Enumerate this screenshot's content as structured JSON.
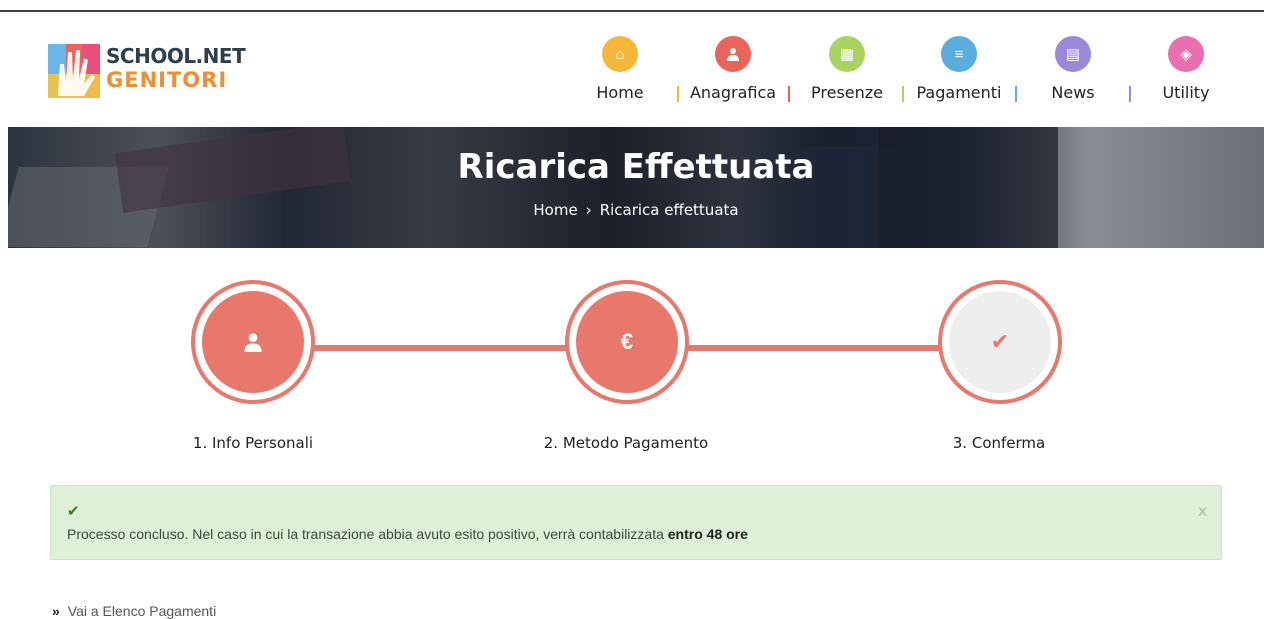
{
  "logo": {
    "line1": "SCHOOL.NET",
    "line2": "GENITORI"
  },
  "nav": [
    {
      "label": "Home",
      "icon": "home-icon",
      "color": "#f4b73a",
      "glyph": "⌂"
    },
    {
      "label": "Anagrafica",
      "icon": "user-icon",
      "color": "#e8655a",
      "glyph": "●"
    },
    {
      "label": "Presenze",
      "icon": "calendar-icon",
      "color": "#a9d360",
      "glyph": "▦"
    },
    {
      "label": "Pagamenti",
      "icon": "list-icon",
      "color": "#5aaedf",
      "glyph": "≡"
    },
    {
      "label": "News",
      "icon": "newspaper-icon",
      "color": "#9a88d8",
      "glyph": "▤"
    },
    {
      "label": "Utility",
      "icon": "utility-icon",
      "color": "#e870b0",
      "glyph": "◈"
    }
  ],
  "banner": {
    "title": "Ricarica Effettuata",
    "breadcrumb_home": "Home",
    "breadcrumb_sep": "›",
    "breadcrumb_current": "Ricarica effettuata"
  },
  "steps": [
    {
      "label": "1. Info Personali",
      "icon": "user-icon",
      "glyph": "●",
      "state": "done"
    },
    {
      "label": "2. Metodo Pagamento",
      "icon": "euro-icon",
      "glyph": "€",
      "state": "done"
    },
    {
      "label": "3. Conferma",
      "icon": "check-icon",
      "glyph": "✔",
      "state": "current"
    }
  ],
  "alert": {
    "check": "✔",
    "text": "Processo concluso. Nel caso in cui la transazione abbia avuto esito positivo, verrà contabilizzata ",
    "bold": "entro 48 ore",
    "close": "x"
  },
  "footer_link": {
    "arrows": "»",
    "label": "Vai a Elenco Pagamenti"
  },
  "colors": {
    "accent": "#e8786c",
    "success_bg": "#dff0d8"
  }
}
